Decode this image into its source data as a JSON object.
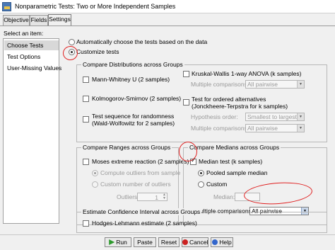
{
  "window": {
    "title": "Nonparametric Tests: Two or More Independent Samples",
    "tabs": [
      {
        "label": "Objective"
      },
      {
        "label": "Fields"
      },
      {
        "label": "Settings"
      }
    ]
  },
  "left": {
    "heading": "Select an item:",
    "items": [
      {
        "label": "Choose Tests",
        "selected": true
      },
      {
        "label": "Test Options"
      },
      {
        "label": "User-Missing Values"
      }
    ]
  },
  "mode": {
    "auto_label": "Automatically choose the tests based on the data",
    "custom_label": "Customize tests"
  },
  "distributions": {
    "title": "Compare Distributions across Groups",
    "mann_whitney": "Mann-Whitney U (2 samples)",
    "kolmogorov": "Kolmogorov-Smirnov (2 samples)",
    "runs_line1": "Test sequence for randomness",
    "runs_line2": "(Wald-Wolfowitz for 2 samples)",
    "kruskal": "Kruskal-Wallis 1-way ANOVA (k samples)",
    "kruskal_mc_label": "Multiple comparisons:",
    "kruskal_mc_value": "All pairwise",
    "ordered_line1": "Test for ordered alternatives",
    "ordered_line2": "(Jonckheere-Terpstra for k samples)",
    "hyp_order_label": "Hypothesis order:",
    "hyp_order_value": "Smallest to largest",
    "ordered_mc_label": "Multiple comparisons:",
    "ordered_mc_value": "All pairwise"
  },
  "ranges": {
    "title": "Compare Ranges across Groups",
    "moses": "Moses extreme reaction (2 samples)",
    "compute_outliers": "Compute outliers from sample",
    "custom_outliers": "Custom number of outliers",
    "outliers_label": "Outliers:",
    "outliers_value": "1"
  },
  "medians": {
    "title": "Compare Medians across Groups",
    "median_test": "Median test (k samples)",
    "pooled": "Pooled sample median",
    "custom": "Custom",
    "median_label": "Median:",
    "mc_label": "Multiple comparisons:",
    "mc_value": "All pairwise"
  },
  "ci": {
    "title": "Estimate Confidence Interval across Groups",
    "hodges": "Hodges-Lehmann estimate (2 samples)"
  },
  "buttons": {
    "run": "Run",
    "paste": "Paste",
    "reset": "Reset",
    "cancel": "Cancel",
    "help": "Help"
  },
  "colors": {
    "annotation": "#e02020",
    "run_icon": "#2e9a2e",
    "help_icon": "#3366cc",
    "cancel_icon": "#cc2222"
  }
}
